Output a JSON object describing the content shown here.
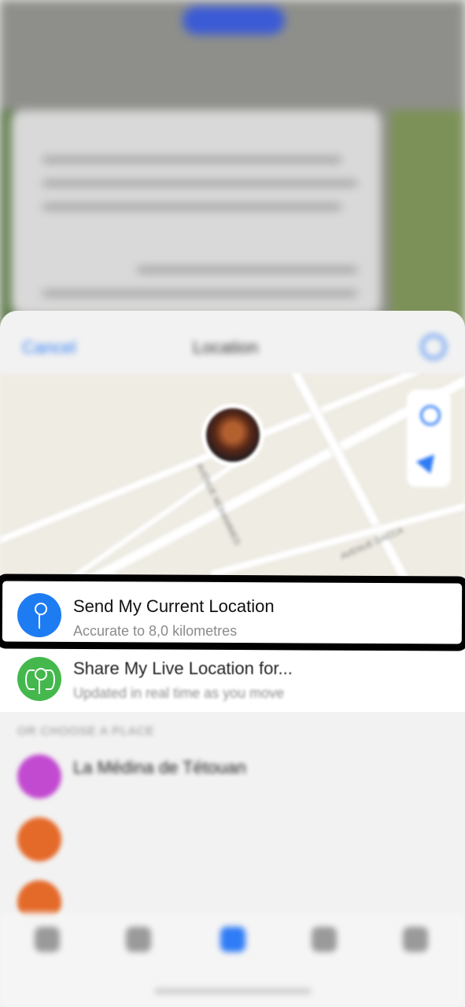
{
  "background_chat": {
    "status_pill": "",
    "nav_title": "",
    "message_lines": [
      "",
      "",
      "",
      ""
    ]
  },
  "sheet": {
    "header": {
      "cancel_label": "Cancel",
      "title": "Location"
    },
    "map": {
      "street_labels": [
        "AVENUE DACCA",
        "AVENUE MOHAMMED"
      ]
    },
    "send_current": {
      "label": "Send My Current Location",
      "sublabel": "Accurate to 8,0 kilometres",
      "icon": "location-pin-icon",
      "icon_color": "#1e7cf2"
    },
    "share_live": {
      "label": "Share My Live Location for...",
      "sublabel": "Updated in real time as you move",
      "icon": "live-location-icon",
      "icon_color": "#44b84c"
    },
    "section_label": "OR CHOOSE A PLACE",
    "places": [
      {
        "name": "La Médina de Tétouan",
        "detail": "",
        "icon_color": "#c24ad0"
      },
      {
        "name": "",
        "detail": "",
        "icon_color": "#e46a2a"
      },
      {
        "name": "",
        "detail": "",
        "icon_color": "#e46a2a"
      }
    ]
  },
  "tabbar": {
    "icons": [
      "chat-icon",
      "contacts-icon",
      "location-icon",
      "music-icon",
      "file-icon"
    ],
    "active_color": "#2f7cf6"
  },
  "highlight_color": "#000000"
}
